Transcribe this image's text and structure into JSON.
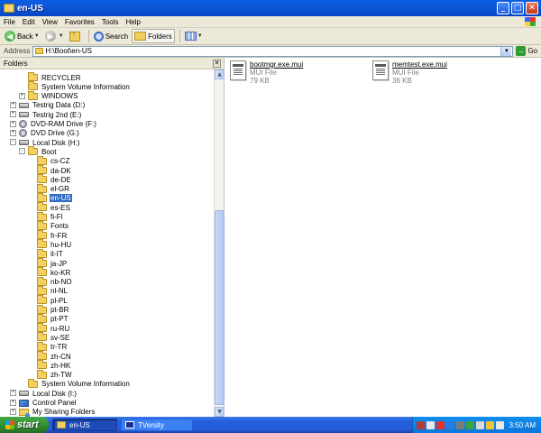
{
  "window": {
    "title": "en-US"
  },
  "menu": [
    "File",
    "Edit",
    "View",
    "Favorites",
    "Tools",
    "Help"
  ],
  "toolbar": {
    "back": "Back",
    "search": "Search",
    "folders": "Folders"
  },
  "address": {
    "label": "Address",
    "value": "H:\\Boot\\en-US",
    "go": "Go"
  },
  "folders_pane": {
    "title": "Folders"
  },
  "tree": [
    {
      "label": "RECYCLER",
      "icon": "folder-icon",
      "exp": ""
    },
    {
      "label": "System Volume Information",
      "icon": "folder-icon",
      "exp": ""
    },
    {
      "label": "WINDOWS",
      "icon": "folder-icon",
      "exp": "+"
    },
    {
      "label": "Testrig Data (D:)",
      "icon": "drive-icon",
      "exp": "+"
    },
    {
      "label": "Testrig 2nd (E:)",
      "icon": "drive-icon",
      "exp": "+"
    },
    {
      "label": "DVD-RAM Drive (F:)",
      "icon": "cdrom-icon",
      "exp": "+"
    },
    {
      "label": "DVD Drive (G:)",
      "icon": "cdrom-icon",
      "exp": "+"
    },
    {
      "label": "Local Disk (H:)",
      "icon": "drive-icon",
      "exp": "-"
    },
    {
      "label": "Boot",
      "icon": "folder-icon",
      "exp": "-"
    },
    {
      "label": "cs-CZ",
      "icon": "folder-icon",
      "exp": ""
    },
    {
      "label": "da-DK",
      "icon": "folder-icon",
      "exp": ""
    },
    {
      "label": "de-DE",
      "icon": "folder-icon",
      "exp": ""
    },
    {
      "label": "el-GR",
      "icon": "folder-icon",
      "exp": ""
    },
    {
      "label": "en-US",
      "icon": "folder-icon",
      "exp": "",
      "selected": true
    },
    {
      "label": "es-ES",
      "icon": "folder-icon",
      "exp": ""
    },
    {
      "label": "fi-FI",
      "icon": "folder-icon",
      "exp": ""
    },
    {
      "label": "Fonts",
      "icon": "folder-icon",
      "exp": ""
    },
    {
      "label": "fr-FR",
      "icon": "folder-icon",
      "exp": ""
    },
    {
      "label": "hu-HU",
      "icon": "folder-icon",
      "exp": ""
    },
    {
      "label": "it-IT",
      "icon": "folder-icon",
      "exp": ""
    },
    {
      "label": "ja-JP",
      "icon": "folder-icon",
      "exp": ""
    },
    {
      "label": "ko-KR",
      "icon": "folder-icon",
      "exp": ""
    },
    {
      "label": "nb-NO",
      "icon": "folder-icon",
      "exp": ""
    },
    {
      "label": "nl-NL",
      "icon": "folder-icon",
      "exp": ""
    },
    {
      "label": "pl-PL",
      "icon": "folder-icon",
      "exp": ""
    },
    {
      "label": "pt-BR",
      "icon": "folder-icon",
      "exp": ""
    },
    {
      "label": "pt-PT",
      "icon": "folder-icon",
      "exp": ""
    },
    {
      "label": "ru-RU",
      "icon": "folder-icon",
      "exp": ""
    },
    {
      "label": "sv-SE",
      "icon": "folder-icon",
      "exp": ""
    },
    {
      "label": "tr-TR",
      "icon": "folder-icon",
      "exp": ""
    },
    {
      "label": "zh-CN",
      "icon": "folder-icon",
      "exp": ""
    },
    {
      "label": "zh-HK",
      "icon": "folder-icon",
      "exp": ""
    },
    {
      "label": "zh-TW",
      "icon": "folder-icon",
      "exp": ""
    },
    {
      "label": "System Volume Information",
      "icon": "folder-icon",
      "exp": ""
    },
    {
      "label": "Local Disk (I:)",
      "icon": "drive-icon",
      "exp": "+"
    },
    {
      "label": "Control Panel",
      "icon": "control-panel-icon",
      "exp": "+"
    },
    {
      "label": "My Sharing Folders",
      "icon": "sharing-folder-icon",
      "exp": "+"
    }
  ],
  "files": [
    {
      "name": "bootmgr.exe.mui",
      "type": "MUI File",
      "size": "79 KB"
    },
    {
      "name": "memtest.exe.mui",
      "type": "MUI File",
      "size": "36 KB"
    }
  ],
  "taskbar": {
    "start": "start",
    "tasks": [
      "en-US",
      "TVersity"
    ],
    "clock": "3:50 AM"
  }
}
